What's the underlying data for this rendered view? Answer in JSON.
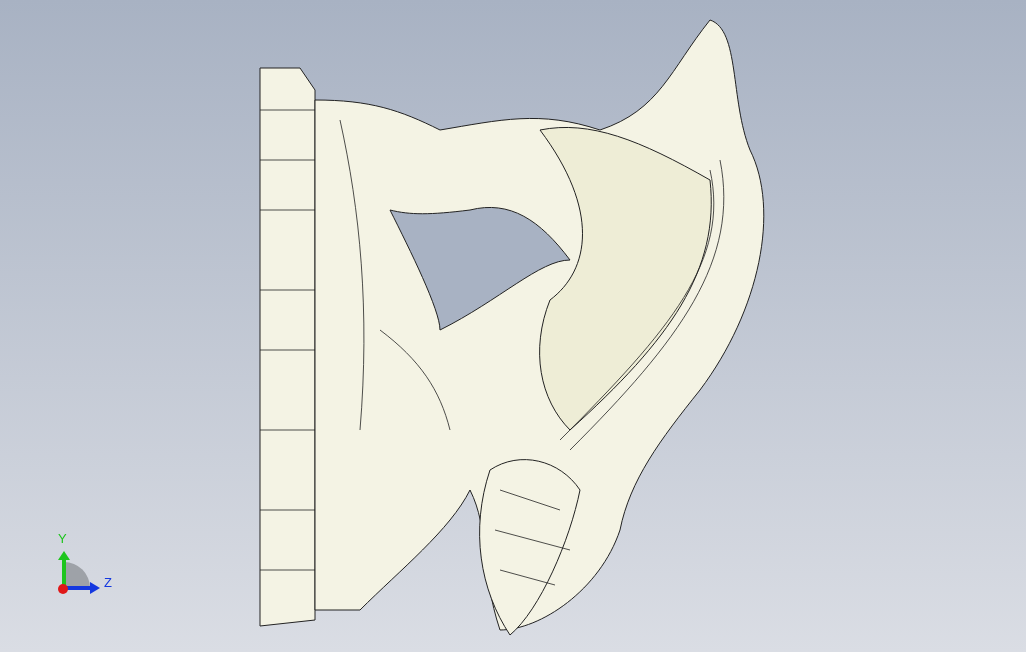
{
  "viewport": {
    "axis_triad": {
      "y_label": "Y",
      "z_label": "Z"
    }
  }
}
